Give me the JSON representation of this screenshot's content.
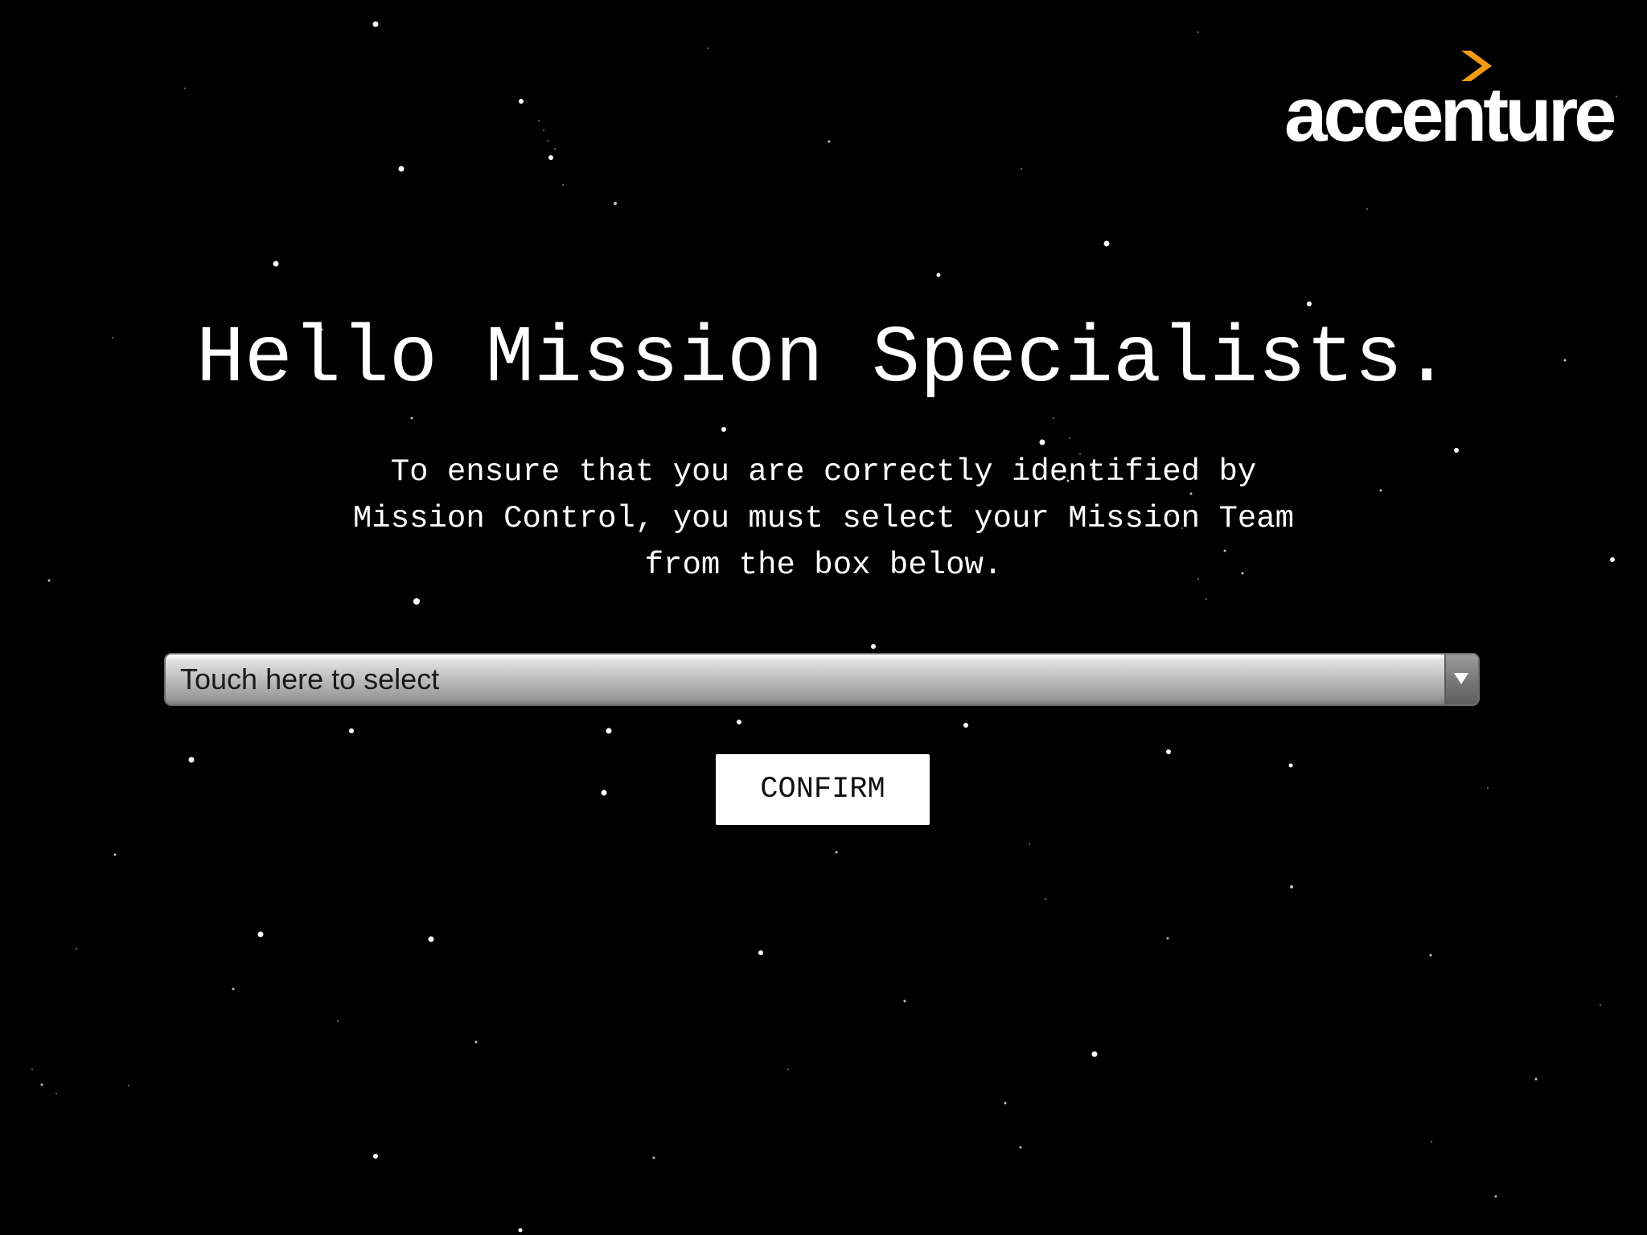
{
  "brand": {
    "name": "accenture",
    "accent_color": "#f39c12",
    "icon": "accenture-chevron-icon"
  },
  "headline": "Hello Mission Specialists.",
  "instructions": "To ensure that you are correctly identified by Mission Control, you must select your Mission Team from the box below.",
  "team_select": {
    "selected_text": "Touch here to select",
    "arrow_icon": "chevron-down-icon"
  },
  "confirm_button": {
    "label": "CONFIRM"
  },
  "colors": {
    "background": "#000000",
    "text": "#ffffff",
    "button_background": "#ffffff"
  }
}
